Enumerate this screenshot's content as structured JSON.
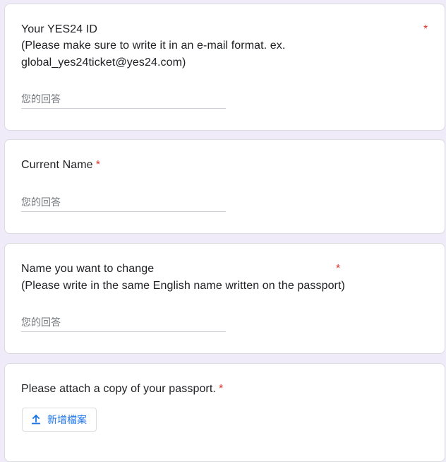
{
  "questions": [
    {
      "title_lines": [
        "Your YES24 ID",
        "(Please make sure to write it in an e-mail format. ex.",
        "global_yes24ticket@yes24.com)"
      ],
      "required_mark": "*",
      "placeholder": "您的回答"
    },
    {
      "title": "Current Name",
      "required_mark": "*",
      "placeholder": "您的回答"
    },
    {
      "title_lines": [
        "Name you want to change",
        "(Please write in the same English name written on the passport)"
      ],
      "required_mark": "*",
      "placeholder": "您的回答"
    },
    {
      "title": "Please attach a copy of your passport.",
      "required_mark": "*",
      "upload_button_label": "新增檔案",
      "upload_icon": "upload-icon"
    }
  ],
  "colors": {
    "background": "#f0ebf8",
    "required": "#d93025",
    "accent": "#1a73e8",
    "text": "#202124",
    "placeholder": "#70757a"
  }
}
